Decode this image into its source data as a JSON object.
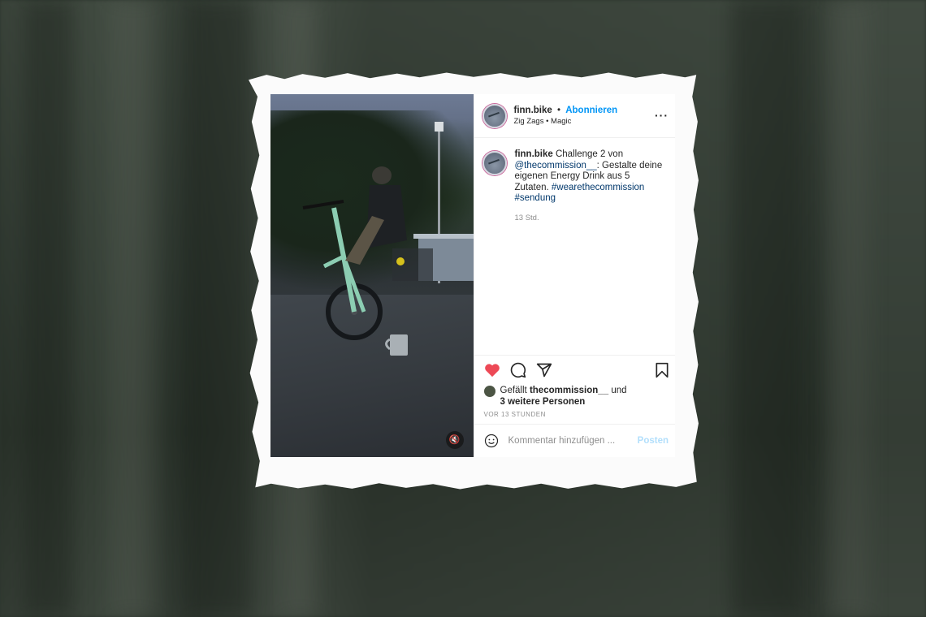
{
  "post": {
    "username": "finn.bike",
    "follow_label": "Abonnieren",
    "music": "Zig Zags • Magic",
    "more_icon": "more-icon",
    "caption": {
      "username": "finn.bike",
      "text_1": "Challenge 2 von",
      "mention": "@thecommission__",
      "text_2": ": Gestalte deine eigenen Energy Drink aus 5 Zutaten.",
      "hashtag_1": "#wearethecommission",
      "hashtag_2": "#sendung",
      "time": "13 Std."
    },
    "actions": {
      "like_icon": "heart-icon",
      "comment_icon": "comment-icon",
      "share_icon": "share-icon",
      "save_icon": "bookmark-icon",
      "like_color": "#ed4956"
    },
    "likes": {
      "prefix": "Gefällt",
      "user": "thecommission__",
      "and": "und",
      "others": "3 weitere Personen"
    },
    "ago": "VOR 13 STUNDEN",
    "comment": {
      "placeholder": "Kommentar hinzufügen ...",
      "post_label": "Posten"
    },
    "video": {
      "mute_icon": "mute-icon"
    }
  }
}
